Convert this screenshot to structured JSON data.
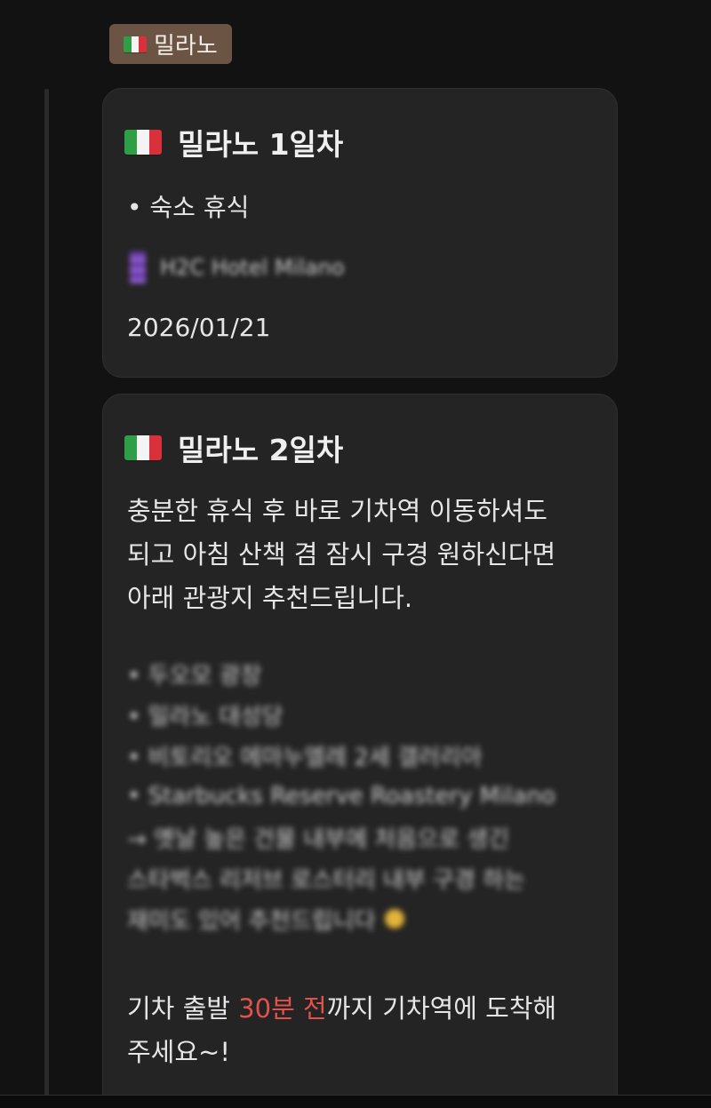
{
  "city_tag": {
    "flag_icon": "italy-flag-icon",
    "label": "밀라노"
  },
  "colors": {
    "background": "#121212",
    "card": "#242424",
    "tag": "#6b5444",
    "highlight": "#e0524b"
  },
  "days": [
    {
      "flag_icon": "italy-flag-icon",
      "title": "밀라노 1일차",
      "bullet": "• 숙소 휴식",
      "hotel_icon": "hotel-building-icon",
      "hotel_name": "H2C Hotel Milano",
      "date": "2026/01/21"
    },
    {
      "flag_icon": "italy-flag-icon",
      "title": "밀라노 2일차",
      "intro_line1": "충분한 휴식 후 바로 기차역 이동하셔도",
      "intro_line2": "되고 아침 산책 겸 잠시 구경 원하신다면",
      "intro_line3": "아래 관광지 추천드립니다.",
      "blurred_lines": [
        "• 두오모 광장",
        "• 밀라노 대성당",
        "• 비토리오 에마누엘레 2세 갤러리아",
        "• Starbucks Reserve Roastery Milano",
        "→ 옛날 높은 건물 내부에 처음으로 생긴",
        "스타벅스 리저브 로스터리 내부 구경 하는",
        "재미도 있어 추천드립니다 "
      ],
      "closing_before": "기차 출발 ",
      "closing_highlight": "30분 전",
      "closing_after": "까지 기차역에 도착해",
      "closing_line2": "주세요~!"
    }
  ]
}
